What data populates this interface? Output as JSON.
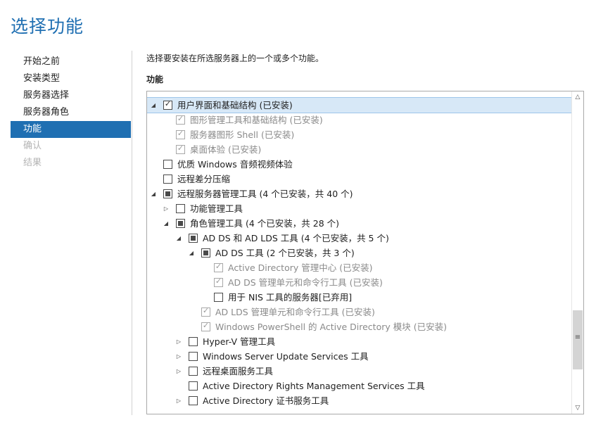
{
  "title": "选择功能",
  "nav": {
    "items": [
      {
        "label": "开始之前",
        "state": "normal"
      },
      {
        "label": "安装类型",
        "state": "normal"
      },
      {
        "label": "服务器选择",
        "state": "normal"
      },
      {
        "label": "服务器角色",
        "state": "normal"
      },
      {
        "label": "功能",
        "state": "active"
      },
      {
        "label": "确认",
        "state": "disabled"
      },
      {
        "label": "结果",
        "state": "disabled"
      }
    ]
  },
  "main": {
    "instruction": "选择要安装在所选服务器上的一个或多个功能。",
    "features_label": "功能"
  },
  "tree": {
    "rows": [
      {
        "level": 0,
        "expander": "expanded",
        "check": "checked",
        "label": "用户界面和基础结构 (已安装)",
        "grayed": false,
        "selected": true
      },
      {
        "level": 1,
        "expander": "none",
        "check": "checked",
        "label": "图形管理工具和基础结构 (已安装)",
        "grayed": true
      },
      {
        "level": 1,
        "expander": "none",
        "check": "checked",
        "label": "服务器图形 Shell (已安装)",
        "grayed": true
      },
      {
        "level": 1,
        "expander": "none",
        "check": "checked",
        "label": "桌面体验 (已安装)",
        "grayed": true
      },
      {
        "level": 0,
        "expander": "none",
        "check": "unchecked",
        "label": "优质 Windows 音频视频体验",
        "grayed": false
      },
      {
        "level": 0,
        "expander": "none",
        "check": "unchecked",
        "label": "远程差分压缩",
        "grayed": false
      },
      {
        "level": 0,
        "expander": "expanded",
        "check": "partial",
        "label": "远程服务器管理工具 (4 个已安装，共 40 个)",
        "grayed": false
      },
      {
        "level": 1,
        "expander": "collapsed",
        "check": "unchecked",
        "label": "功能管理工具",
        "grayed": false
      },
      {
        "level": 1,
        "expander": "expanded",
        "check": "partial",
        "label": "角色管理工具 (4 个已安装，共 28 个)",
        "grayed": false
      },
      {
        "level": 2,
        "expander": "expanded",
        "check": "partial",
        "label": "AD DS 和 AD LDS 工具 (4 个已安装，共 5 个)",
        "grayed": false
      },
      {
        "level": 3,
        "expander": "expanded",
        "check": "partial",
        "label": "AD DS 工具 (2 个已安装，共 3 个)",
        "grayed": false
      },
      {
        "level": 4,
        "expander": "none",
        "check": "checked",
        "label": "Active Directory 管理中心 (已安装)",
        "grayed": true
      },
      {
        "level": 4,
        "expander": "none",
        "check": "checked",
        "label": "AD DS 管理单元和命令行工具 (已安装)",
        "grayed": true
      },
      {
        "level": 4,
        "expander": "none",
        "check": "unchecked",
        "label": "用于 NIS 工具的服务器[已弃用]",
        "grayed": false
      },
      {
        "level": 3,
        "expander": "none",
        "check": "checked",
        "label": "AD LDS 管理单元和命令行工具 (已安装)",
        "grayed": true
      },
      {
        "level": 3,
        "expander": "none",
        "check": "checked",
        "label": "Windows PowerShell 的 Active Directory 模块 (已安装)",
        "grayed": true
      },
      {
        "level": 2,
        "expander": "collapsed",
        "check": "unchecked",
        "label": "Hyper-V 管理工具",
        "grayed": false
      },
      {
        "level": 2,
        "expander": "collapsed",
        "check": "unchecked",
        "label": "Windows Server Update Services 工具",
        "grayed": false
      },
      {
        "level": 2,
        "expander": "collapsed",
        "check": "unchecked",
        "label": "远程桌面服务工具",
        "grayed": false
      },
      {
        "level": 2,
        "expander": "none",
        "check": "unchecked",
        "label": "Active Directory Rights Management Services 工具",
        "grayed": false
      },
      {
        "level": 2,
        "expander": "collapsed",
        "check": "unchecked",
        "label": "Active Directory 证书服务工具",
        "grayed": false
      }
    ]
  },
  "icons": {
    "expanded": "triangle-expanded-icon",
    "collapsed": "triangle-collapsed-icon",
    "scroll_up": "chevron-up-icon",
    "scroll_down": "chevron-down-icon",
    "grip": "scroll-grip-icon"
  },
  "colors": {
    "accent": "#1f6fb2",
    "selected_row": "#d7e8f7",
    "disabled_text": "#b4b4b4",
    "grayed_text": "#8a8a8a"
  }
}
